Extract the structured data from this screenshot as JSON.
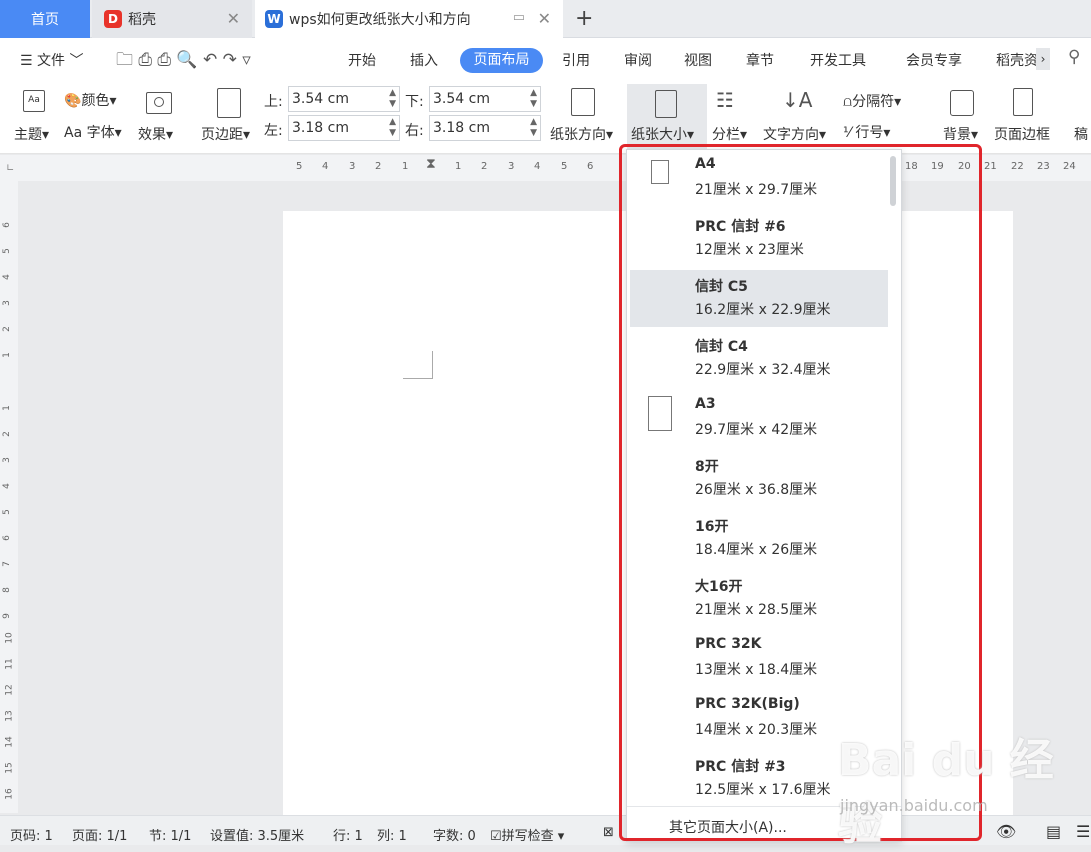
{
  "tabs": {
    "home": "首页",
    "daoke": "稻壳",
    "doc": "wps如何更改纸张大小和方向"
  },
  "menu": {
    "file": "文件",
    "items": [
      "开始",
      "插入",
      "页面布局",
      "引用",
      "审阅",
      "视图",
      "章节",
      "开发工具",
      "会员专享",
      "稻壳资"
    ],
    "active": "页面布局"
  },
  "ribbon": {
    "theme": "主题",
    "color": "颜色",
    "font": "Aa 字体",
    "effect": "效果",
    "margin": "页边距",
    "top_label": "上:",
    "top_value": "3.54 cm",
    "bottom_label": "下:",
    "bottom_value": "3.54 cm",
    "left_label": "左:",
    "left_value": "3.18 cm",
    "right_label": "右:",
    "right_value": "3.18 cm",
    "orientation": "纸张方向",
    "size": "纸张大小",
    "columns": "分栏",
    "text_direction": "文字方向",
    "separator": "分隔符",
    "line_number": "行号",
    "background": "背景",
    "border": "页面边框",
    "more": "稿"
  },
  "ruler": {
    "h": [
      "5",
      "4",
      "3",
      "2",
      "1",
      "1",
      "2",
      "3",
      "4",
      "5",
      "6",
      "18",
      "19",
      "20",
      "21",
      "22",
      "23",
      "24"
    ],
    "v": [
      "6",
      "5",
      "4",
      "3",
      "2",
      "1",
      "1",
      "2",
      "3",
      "4",
      "5",
      "6",
      "7",
      "8",
      "9",
      "10",
      "11",
      "12",
      "13",
      "14",
      "15",
      "16"
    ]
  },
  "paper_sizes": [
    {
      "name": "A4",
      "dim": "21厘米 x 29.7厘米",
      "icon": "small"
    },
    {
      "name": "PRC 信封 #6",
      "dim": "12厘米 x 23厘米",
      "icon": ""
    },
    {
      "name": "信封 C5",
      "dim": "16.2厘米 x 22.9厘米",
      "icon": "",
      "selected": true
    },
    {
      "name": "信封 C4",
      "dim": "22.9厘米 x 32.4厘米",
      "icon": ""
    },
    {
      "name": "A3",
      "dim": "29.7厘米 x 42厘米",
      "icon": "large"
    },
    {
      "name": "8开",
      "dim": "26厘米 x 36.8厘米",
      "icon": ""
    },
    {
      "name": "16开",
      "dim": "18.4厘米 x 26厘米",
      "icon": ""
    },
    {
      "name": "大16开",
      "dim": "21厘米 x 28.5厘米",
      "icon": ""
    },
    {
      "name": "PRC 32K",
      "dim": "13厘米 x 18.4厘米",
      "icon": ""
    },
    {
      "name": "PRC 32K(Big)",
      "dim": "14厘米 x 20.3厘米",
      "icon": ""
    },
    {
      "name": "PRC 信封 #3",
      "dim": "12.5厘米 x 17.6厘米",
      "icon": ""
    }
  ],
  "other_sizes": "其它页面大小(A)...",
  "status": {
    "page_no": "页码: 1",
    "pages": "页面: 1/1",
    "section": "节: 1/1",
    "setting": "设置值: 3.5厘米",
    "row": "行: 1",
    "col": "列: 1",
    "words": "字数: 0",
    "spell": "拼写检查"
  },
  "watermark": {
    "main": "Bai du 经验",
    "sub": "jingyan.baidu.com"
  },
  "colors": {
    "accent": "#4a8af4",
    "highlight": "#e0252b"
  }
}
